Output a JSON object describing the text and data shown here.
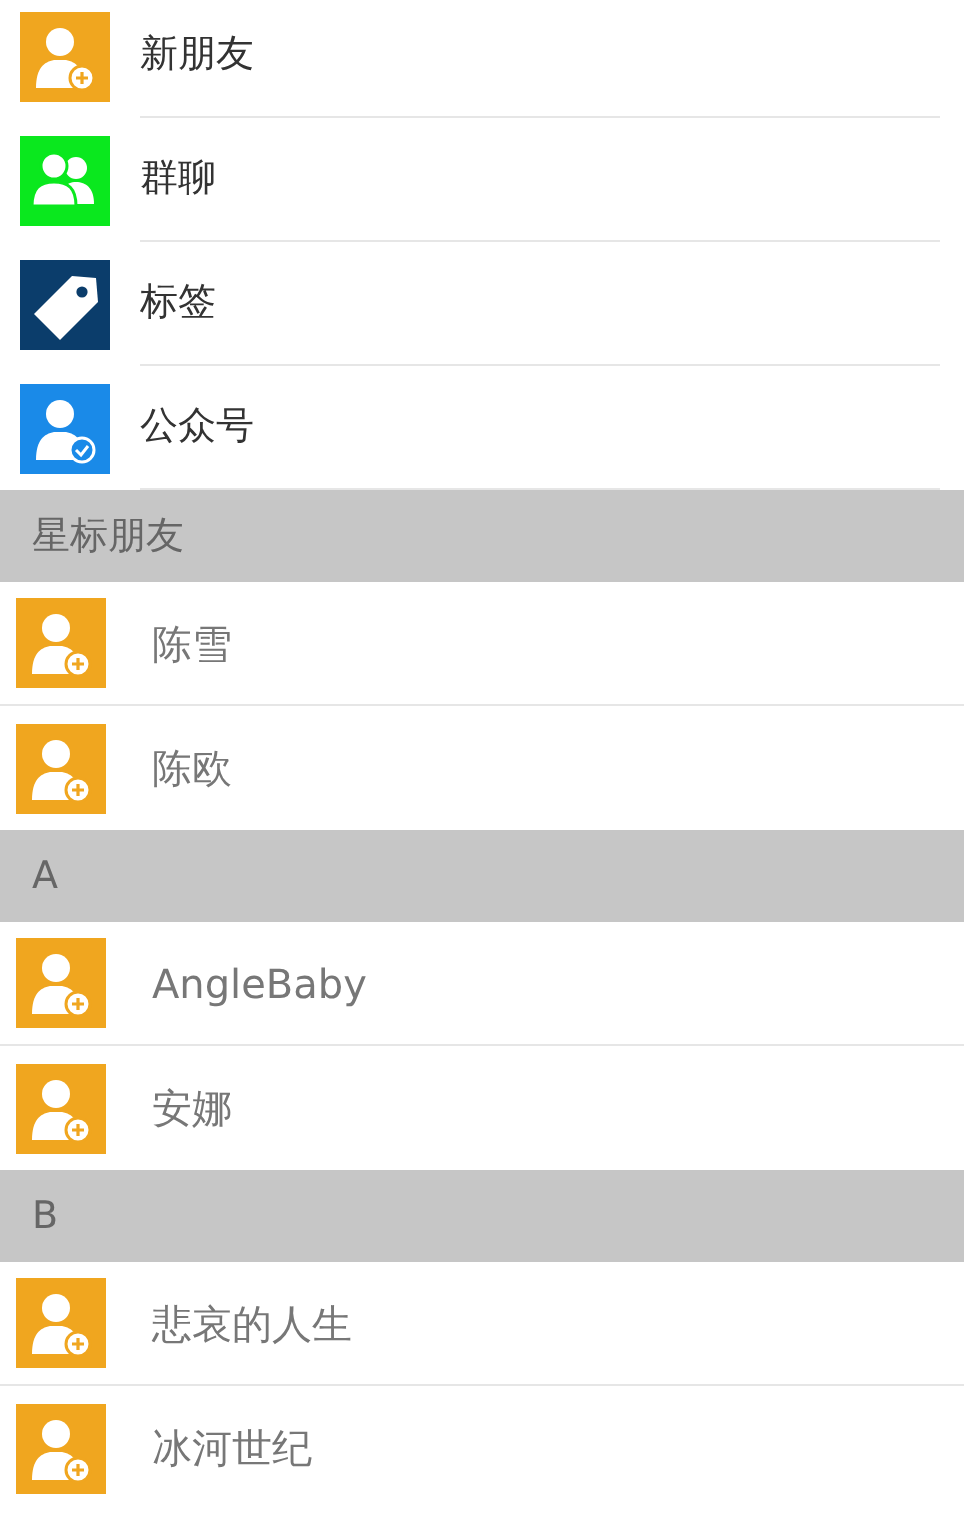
{
  "menu_items": [
    {
      "label": "新朋友",
      "kind": "person-add"
    },
    {
      "label": "群聊",
      "kind": "group"
    },
    {
      "label": "标签",
      "kind": "tag"
    },
    {
      "label": "公众号",
      "kind": "person-check"
    }
  ],
  "sections": [
    {
      "header": "星标朋友",
      "contacts": [
        {
          "name": "陈雪"
        },
        {
          "name": "陈欧"
        }
      ]
    },
    {
      "header": "A",
      "contacts": [
        {
          "name": "AngleBaby"
        },
        {
          "name": "安娜"
        }
      ]
    },
    {
      "header": "B",
      "contacts": [
        {
          "name": "悲哀的人生"
        },
        {
          "name": "冰河世纪"
        }
      ]
    }
  ]
}
